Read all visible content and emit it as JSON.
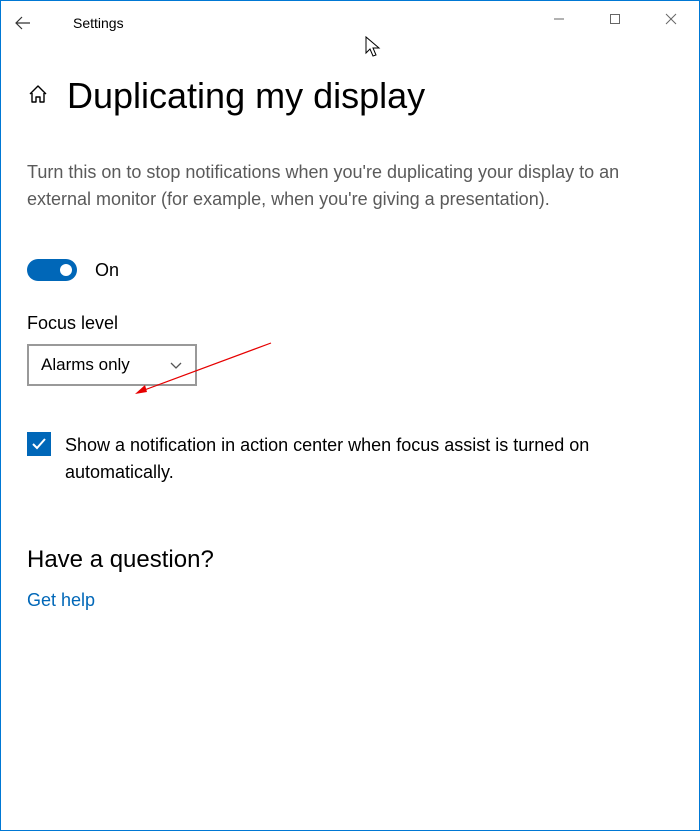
{
  "titlebar": {
    "title": "Settings"
  },
  "page": {
    "title": "Duplicating my display",
    "description": "Turn this on to stop notifications when you're duplicating your display to an external monitor (for example, when you're giving a presentation).",
    "toggle_label": "On",
    "focus_level_label": "Focus level",
    "dropdown_value": "Alarms only",
    "checkbox_label": "Show a notification in action center when focus assist is turned on automatically.",
    "question_heading": "Have a question?",
    "help_link": "Get help"
  }
}
